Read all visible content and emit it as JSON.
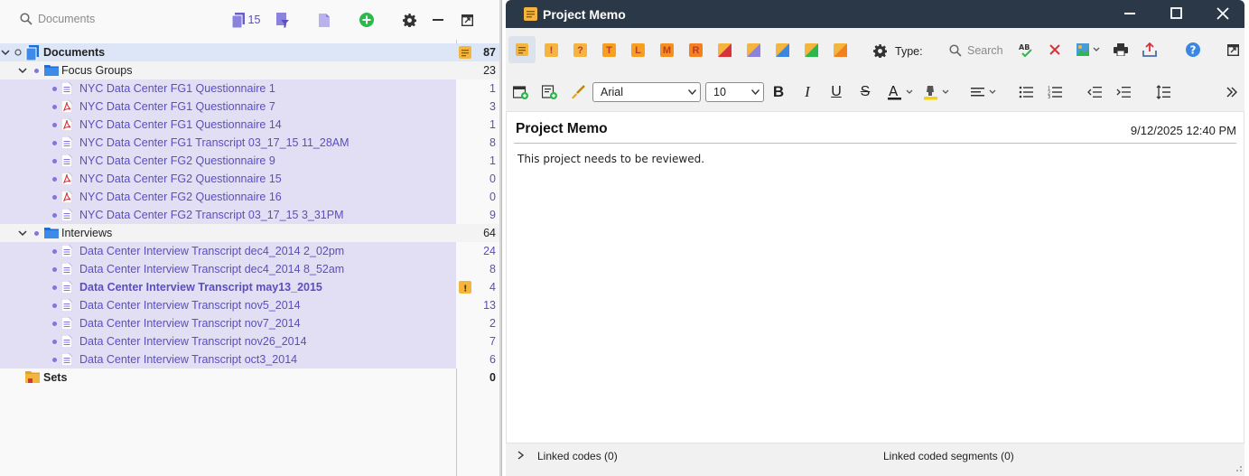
{
  "left_panel": {
    "search_placeholder": "Documents",
    "doc_count_badge": "15",
    "tree": {
      "root": {
        "label": "Documents",
        "count": "87"
      },
      "groups": [
        {
          "label": "Focus Groups",
          "count": "23",
          "items": [
            {
              "label": "NYC Data Center FG1 Questionnaire 1",
              "type": "text",
              "count": "1"
            },
            {
              "label": "NYC Data Center FG1 Questionnaire 7",
              "type": "pdf",
              "count": "3"
            },
            {
              "label": "NYC Data Center FG1 Questionnaire 14",
              "type": "pdf",
              "count": "1"
            },
            {
              "label": "NYC Data Center FG1 Transcript 03_17_15 11_28AM",
              "type": "text",
              "count": "8"
            },
            {
              "label": "NYC Data Center FG2 Questionnaire 9",
              "type": "text",
              "count": "1"
            },
            {
              "label": "NYC Data Center FG2 Questionnaire 15",
              "type": "pdf",
              "count": "0"
            },
            {
              "label": "NYC Data Center FG2 Questionnaire 16",
              "type": "pdf",
              "count": "0"
            },
            {
              "label": "NYC Data Center FG2 Transcript 03_17_15 3_31PM",
              "type": "text",
              "count": "9"
            }
          ]
        },
        {
          "label": "Interviews",
          "count": "64",
          "items": [
            {
              "label": "Data Center Interview Transcript dec4_2014 2_02pm",
              "type": "text",
              "count": "24"
            },
            {
              "label": "Data Center Interview Transcript dec4_2014 8_52am",
              "type": "text",
              "count": "8"
            },
            {
              "label": "Data Center Interview Transcript may13_2015",
              "type": "text",
              "count": "4"
            },
            {
              "label": "Data Center Interview Transcript nov5_2014",
              "type": "text",
              "count": "13"
            },
            {
              "label": "Data Center Interview Transcript nov7_2014",
              "type": "text",
              "count": "2"
            },
            {
              "label": "Data Center Interview Transcript nov26_2014",
              "type": "text",
              "count": "7"
            },
            {
              "label": "Data Center Interview Transcript oct3_2014",
              "type": "text",
              "count": "6"
            }
          ]
        }
      ],
      "sets": {
        "label": "Sets",
        "count": "0"
      }
    }
  },
  "memo_window": {
    "title": "Project Memo",
    "type_label": "Type:",
    "search_placeholder": "Search",
    "font_family": "Arial",
    "font_size": "10",
    "memo_type_letters": [
      "!",
      "?",
      "T",
      "L",
      "M",
      "R"
    ],
    "heading": "Project Memo",
    "date": "9/12/2025 12:40 PM",
    "body_text": "This project needs to be reviewed.",
    "linked_codes": "Linked codes (0)",
    "linked_segments": "Linked coded segments (0)"
  },
  "colors": {
    "accent_purple": "#5a4ec0",
    "folder_blue": "#1a6fd6",
    "memo_yellow": "#f4b53f",
    "titlebar": "#2b3848",
    "add_green": "#2db84d"
  }
}
